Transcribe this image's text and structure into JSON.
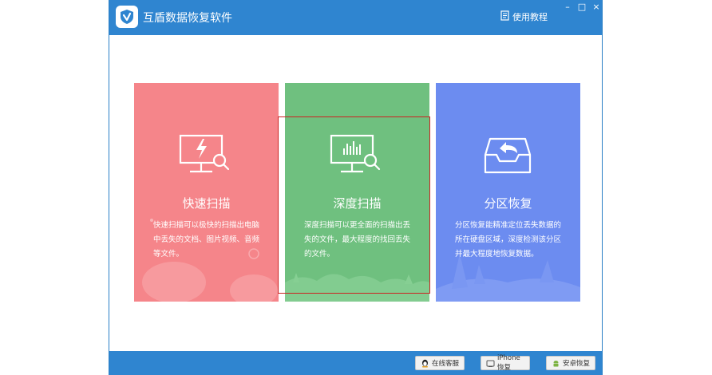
{
  "window": {
    "title": "互盾数据恢复软件"
  },
  "header": {
    "help_label": "使用教程"
  },
  "window_controls": {
    "min": "–",
    "max": "□",
    "close": "×"
  },
  "cards": [
    {
      "title": "快速扫描",
      "description": "快速扫描可以极快的扫描出电脑中丢失的文档、图片视频、音频等文件。",
      "color": "#f5858a",
      "icon": "monitor-lightning-icon"
    },
    {
      "title": "深度扫描",
      "description": "深度扫描可以更全面的扫描出丢失的文件，最大程度的找回丢失的文件。",
      "color": "#6fc07f",
      "icon": "monitor-chart-icon"
    },
    {
      "title": "分区恢复",
      "description": "分区恢复能精准定位丢失数据的所在硬盘区域，深度检测该分区并最大程度地恢复数据。",
      "color": "#6c8cf0",
      "icon": "inbox-return-icon"
    }
  ],
  "bottom": {
    "online_service": "在线客服",
    "iphone_recovery": "iPhone恢复",
    "android_recovery": "安卓恢复"
  },
  "colors": {
    "titlebar": "#2f85d0",
    "highlight": "#cc2222"
  }
}
